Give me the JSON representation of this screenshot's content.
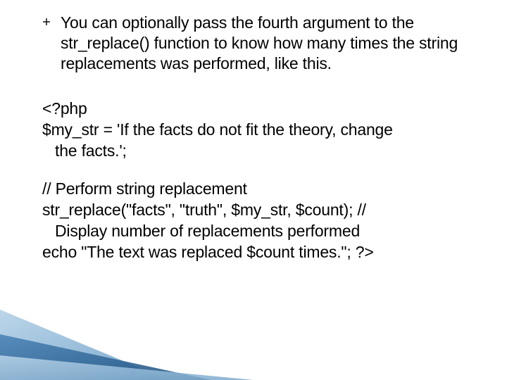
{
  "bullet": {
    "text": "You can optionally pass the fourth argument to the str_replace() function to know how many times the string replacements was performed, like this."
  },
  "code": {
    "p1_l1": "<?php",
    "p1_l2": "$my_str = 'If the facts do not fit the theory, change",
    "p1_l3": "the facts.';",
    "p2_l1": "// Perform string replacement",
    "p2_l2": "str_replace(\"facts\", \"truth\", $my_str, $count); //",
    "p2_l3": "Display number of replacements performed",
    "p2_l4": " echo \"The text was replaced $count times.\"; ?>"
  },
  "decor": {
    "wedge_fill_light": "#a5c9e5",
    "wedge_fill_dark": "#2f6aa0"
  }
}
